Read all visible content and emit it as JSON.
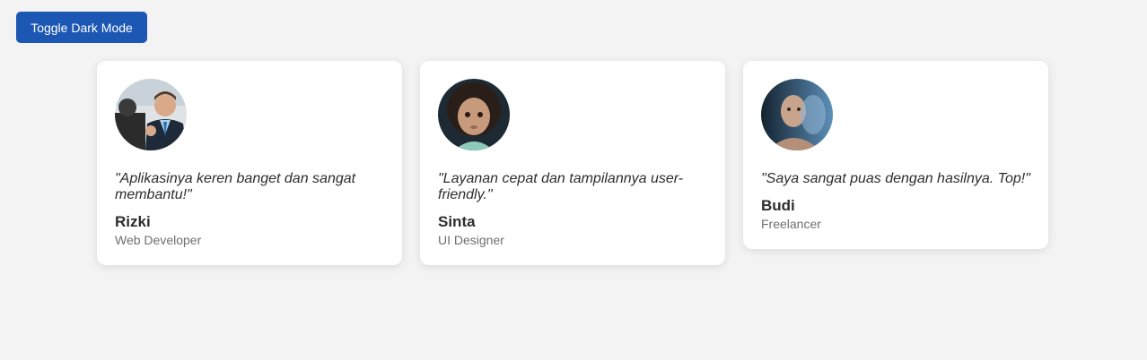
{
  "toolbar": {
    "toggle_label": "Toggle Dark Mode"
  },
  "colors": {
    "accent": "#1b57b3",
    "background": "#f3f3f3",
    "card": "#ffffff"
  },
  "testimonials": [
    {
      "quote": "\"Aplikasinya keren banget dan sangat membantu!\"",
      "name": "Rizki",
      "role": "Web Developer",
      "avatar_icon": "person-photo-icon"
    },
    {
      "quote": "\"Layanan cepat dan tampilannya user-friendly.\"",
      "name": "Sinta",
      "role": "UI Designer",
      "avatar_icon": "person-photo-icon"
    },
    {
      "quote": "\"Saya sangat puas dengan hasilnya. Top!\"",
      "name": "Budi",
      "role": "Freelancer",
      "avatar_icon": "person-photo-icon"
    }
  ]
}
